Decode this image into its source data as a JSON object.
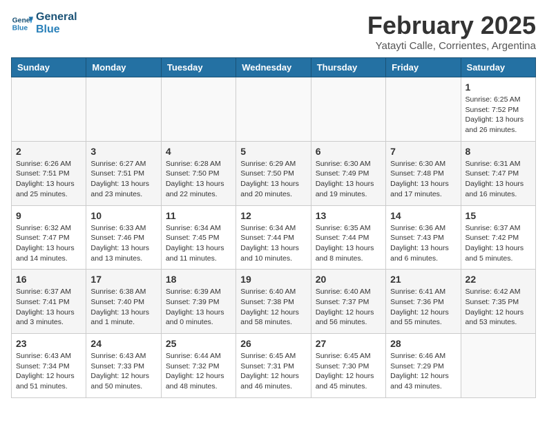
{
  "logo": {
    "line1": "General",
    "line2": "Blue"
  },
  "header": {
    "month": "February 2025",
    "location": "Yatayti Calle, Corrientes, Argentina"
  },
  "weekdays": [
    "Sunday",
    "Monday",
    "Tuesday",
    "Wednesday",
    "Thursday",
    "Friday",
    "Saturday"
  ],
  "weeks": [
    [
      {
        "day": "",
        "info": ""
      },
      {
        "day": "",
        "info": ""
      },
      {
        "day": "",
        "info": ""
      },
      {
        "day": "",
        "info": ""
      },
      {
        "day": "",
        "info": ""
      },
      {
        "day": "",
        "info": ""
      },
      {
        "day": "1",
        "info": "Sunrise: 6:25 AM\nSunset: 7:52 PM\nDaylight: 13 hours and 26 minutes."
      }
    ],
    [
      {
        "day": "2",
        "info": "Sunrise: 6:26 AM\nSunset: 7:51 PM\nDaylight: 13 hours and 25 minutes."
      },
      {
        "day": "3",
        "info": "Sunrise: 6:27 AM\nSunset: 7:51 PM\nDaylight: 13 hours and 23 minutes."
      },
      {
        "day": "4",
        "info": "Sunrise: 6:28 AM\nSunset: 7:50 PM\nDaylight: 13 hours and 22 minutes."
      },
      {
        "day": "5",
        "info": "Sunrise: 6:29 AM\nSunset: 7:50 PM\nDaylight: 13 hours and 20 minutes."
      },
      {
        "day": "6",
        "info": "Sunrise: 6:30 AM\nSunset: 7:49 PM\nDaylight: 13 hours and 19 minutes."
      },
      {
        "day": "7",
        "info": "Sunrise: 6:30 AM\nSunset: 7:48 PM\nDaylight: 13 hours and 17 minutes."
      },
      {
        "day": "8",
        "info": "Sunrise: 6:31 AM\nSunset: 7:47 PM\nDaylight: 13 hours and 16 minutes."
      }
    ],
    [
      {
        "day": "9",
        "info": "Sunrise: 6:32 AM\nSunset: 7:47 PM\nDaylight: 13 hours and 14 minutes."
      },
      {
        "day": "10",
        "info": "Sunrise: 6:33 AM\nSunset: 7:46 PM\nDaylight: 13 hours and 13 minutes."
      },
      {
        "day": "11",
        "info": "Sunrise: 6:34 AM\nSunset: 7:45 PM\nDaylight: 13 hours and 11 minutes."
      },
      {
        "day": "12",
        "info": "Sunrise: 6:34 AM\nSunset: 7:44 PM\nDaylight: 13 hours and 10 minutes."
      },
      {
        "day": "13",
        "info": "Sunrise: 6:35 AM\nSunset: 7:44 PM\nDaylight: 13 hours and 8 minutes."
      },
      {
        "day": "14",
        "info": "Sunrise: 6:36 AM\nSunset: 7:43 PM\nDaylight: 13 hours and 6 minutes."
      },
      {
        "day": "15",
        "info": "Sunrise: 6:37 AM\nSunset: 7:42 PM\nDaylight: 13 hours and 5 minutes."
      }
    ],
    [
      {
        "day": "16",
        "info": "Sunrise: 6:37 AM\nSunset: 7:41 PM\nDaylight: 13 hours and 3 minutes."
      },
      {
        "day": "17",
        "info": "Sunrise: 6:38 AM\nSunset: 7:40 PM\nDaylight: 13 hours and 1 minute."
      },
      {
        "day": "18",
        "info": "Sunrise: 6:39 AM\nSunset: 7:39 PM\nDaylight: 13 hours and 0 minutes."
      },
      {
        "day": "19",
        "info": "Sunrise: 6:40 AM\nSunset: 7:38 PM\nDaylight: 12 hours and 58 minutes."
      },
      {
        "day": "20",
        "info": "Sunrise: 6:40 AM\nSunset: 7:37 PM\nDaylight: 12 hours and 56 minutes."
      },
      {
        "day": "21",
        "info": "Sunrise: 6:41 AM\nSunset: 7:36 PM\nDaylight: 12 hours and 55 minutes."
      },
      {
        "day": "22",
        "info": "Sunrise: 6:42 AM\nSunset: 7:35 PM\nDaylight: 12 hours and 53 minutes."
      }
    ],
    [
      {
        "day": "23",
        "info": "Sunrise: 6:43 AM\nSunset: 7:34 PM\nDaylight: 12 hours and 51 minutes."
      },
      {
        "day": "24",
        "info": "Sunrise: 6:43 AM\nSunset: 7:33 PM\nDaylight: 12 hours and 50 minutes."
      },
      {
        "day": "25",
        "info": "Sunrise: 6:44 AM\nSunset: 7:32 PM\nDaylight: 12 hours and 48 minutes."
      },
      {
        "day": "26",
        "info": "Sunrise: 6:45 AM\nSunset: 7:31 PM\nDaylight: 12 hours and 46 minutes."
      },
      {
        "day": "27",
        "info": "Sunrise: 6:45 AM\nSunset: 7:30 PM\nDaylight: 12 hours and 45 minutes."
      },
      {
        "day": "28",
        "info": "Sunrise: 6:46 AM\nSunset: 7:29 PM\nDaylight: 12 hours and 43 minutes."
      },
      {
        "day": "",
        "info": ""
      }
    ]
  ]
}
